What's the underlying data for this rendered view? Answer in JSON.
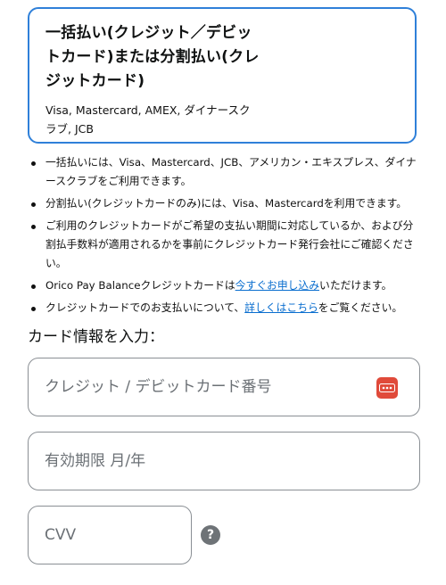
{
  "payment_option": {
    "title": "一括払い(クレジット／デビットカード)または分割払い(クレジットカード)",
    "brands": "Visa, Mastercard, AMEX, ダイナースクラブ, JCB"
  },
  "notes": [
    {
      "text": "一括払いには、Visa、Mastercard、JCB、アメリカン・エキスプレス、ダイナースクラブをご利用できます。"
    },
    {
      "text": "分割払い(クレジットカードのみ)には、Visa、Mastercardを利用できます。"
    },
    {
      "text": "ご利用のクレジットカードがご希望の支払い期間に対応しているか、および分割払手数料が適用されるかを事前にクレジットカード発行会社にご確認ください。"
    },
    {
      "pre": "Orico Pay Balanceクレジットカードは",
      "link": "今すぐお申し込み",
      "post": "いただけます。"
    },
    {
      "pre": "クレジットカードでのお支払いについて、",
      "link": "詳しくはこちら",
      "post": "をご覧ください。"
    }
  ],
  "card_section": {
    "title": "カード情報を入力：",
    "card_number_placeholder": "クレジット / デビットカード番号",
    "expiry_placeholder": "有効期限 月/年",
    "cvv_placeholder": "CVV",
    "help_icon_glyph": "?"
  },
  "colors": {
    "selected_border": "#2f80d9",
    "link": "#0a6ecf",
    "password_manager_icon": "#e04a3a"
  }
}
